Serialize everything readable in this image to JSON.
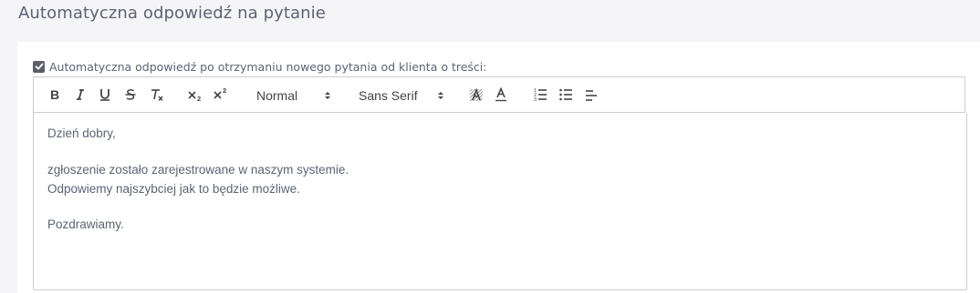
{
  "page": {
    "title": "Automatyczna odpowiedź na pytanie"
  },
  "auto_reply": {
    "checkbox_checked": true,
    "checkbox_label": "Automatyczna odpowiedź po otrzymaniu nowego pytania od klienta o treści:"
  },
  "toolbar": {
    "buttons": [
      "bold-icon",
      "italic-icon",
      "underline-icon",
      "strikethrough-icon",
      "clear-format-icon",
      "subscript-icon",
      "superscript-icon",
      "background-color-icon",
      "text-color-icon",
      "ordered-list-icon",
      "bullet-list-icon",
      "align-icon"
    ],
    "header_picker_value": "Normal",
    "font_picker_value": "Sans Serif"
  },
  "editor": {
    "lines": [
      "Dzień dobry,",
      "zgłoszenie zostało zarejestrowane w naszym systemie.",
      "Odpowiemy najszybciej jak to będzie możliwe.",
      "Pozdrawiamy."
    ]
  },
  "colors": {
    "text": "#5b6473",
    "border": "#cccccc",
    "checkbox": "#5c6066"
  }
}
